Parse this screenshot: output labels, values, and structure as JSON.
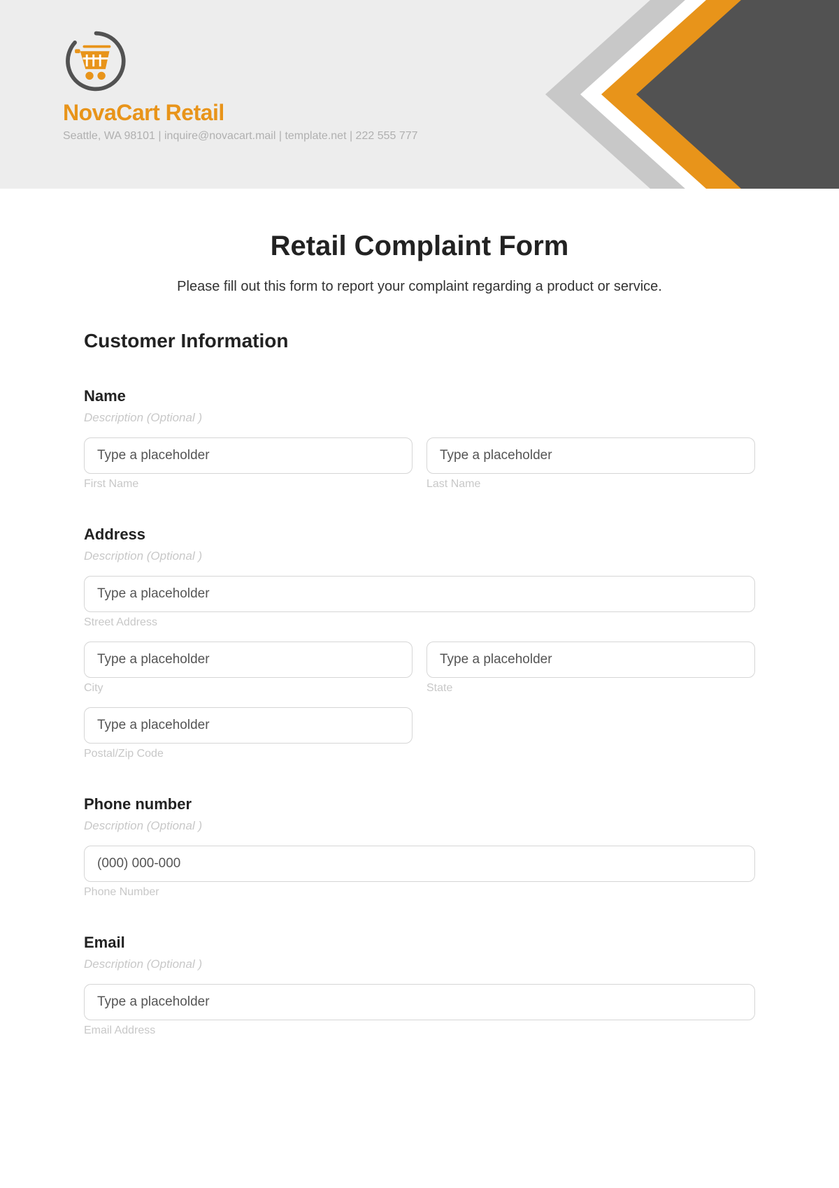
{
  "header": {
    "brand_name": "NovaCart Retail",
    "brand_info": "Seattle, WA 98101 | inquire@novacart.mail | template.net | 222 555 777"
  },
  "form": {
    "title": "Retail Complaint Form",
    "subtitle": "Please fill out this form to report your complaint regarding a product or service.",
    "section_title": "Customer Information",
    "desc_optional": "Description  (Optional )",
    "placeholder_generic": "Type a placeholder",
    "name": {
      "label": "Name",
      "first_sub": "First Name",
      "last_sub": "Last Name"
    },
    "address": {
      "label": "Address",
      "street_sub": "Street Address",
      "city_sub": "City",
      "state_sub": "State",
      "zip_sub": "Postal/Zip Code"
    },
    "phone": {
      "label": "Phone number",
      "placeholder": "(000) 000-000",
      "sub": "Phone Number"
    },
    "email": {
      "label": "Email",
      "sub": "Email Address"
    }
  },
  "colors": {
    "accent": "#e8941a",
    "dark": "#525252",
    "gray": "#c8c8c8"
  }
}
